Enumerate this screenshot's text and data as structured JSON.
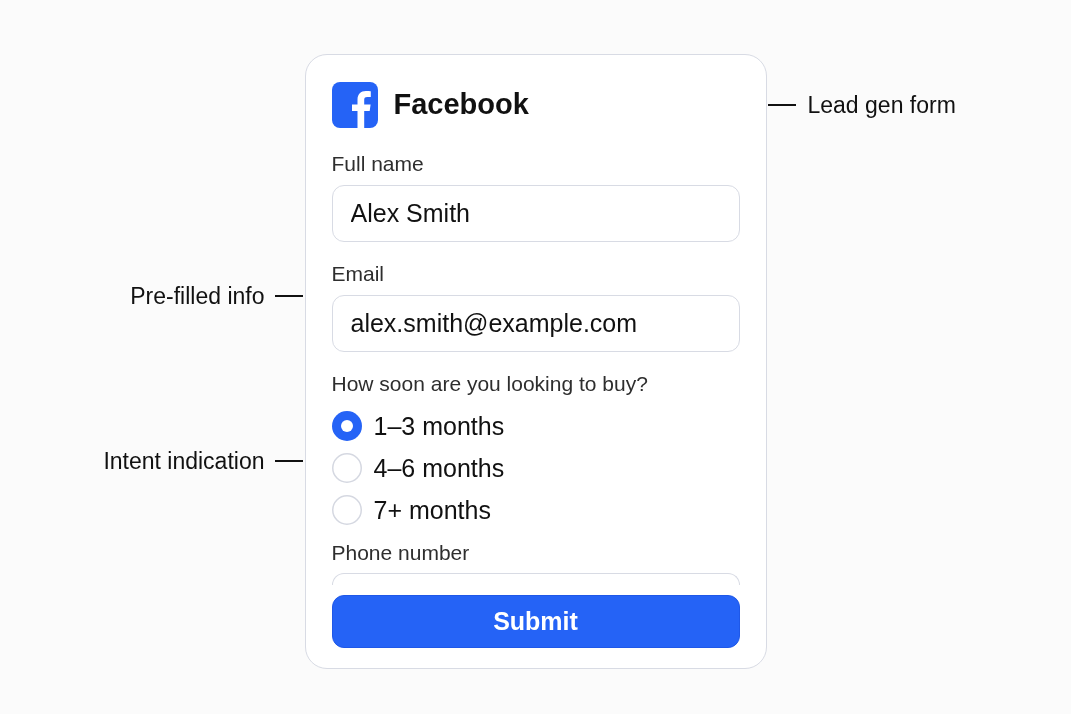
{
  "form": {
    "header": {
      "brand": "Facebook",
      "callout": "Lead gen form"
    },
    "fields": [
      {
        "label": "Full name",
        "value": "Alex Smith"
      },
      {
        "label": "Email",
        "value": "alex.smith@example.com",
        "callout": "Pre-filled info"
      }
    ],
    "question": {
      "label": "How soon are you looking to buy?",
      "callout": "Intent indication",
      "options": [
        {
          "label": "1–3 months",
          "selected": true
        },
        {
          "label": "4–6 months",
          "selected": false
        },
        {
          "label": "7+ months",
          "selected": false
        }
      ]
    },
    "phone": {
      "label": "Phone number"
    },
    "submit": "Submit"
  }
}
